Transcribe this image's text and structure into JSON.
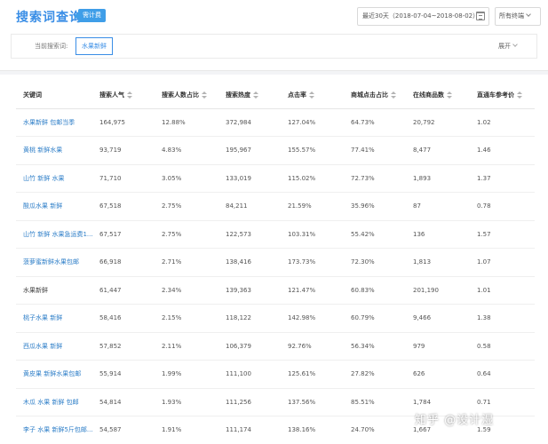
{
  "header": {
    "title": "搜索词查询",
    "badge": "需计费",
    "date_range": "最近30天（2018-07-04~2018-08-02）",
    "terminal_select": "所有终端"
  },
  "current_keyword": {
    "label": "当前搜索词:",
    "tag": "水果新鲜",
    "expand": "展开"
  },
  "table": {
    "columns": [
      "关键词",
      "搜索人气",
      "搜索人数占比",
      "搜索热度",
      "点击率",
      "商城点击占比",
      "在线商品数",
      "直通车参考价"
    ],
    "rows": [
      [
        "水果新鲜 包邮当季",
        "164,975",
        "12.88%",
        "372,984",
        "127.04%",
        "64.73%",
        "20,792",
        "1.02"
      ],
      [
        "黄桃 新鲜水果",
        "93,719",
        "4.83%",
        "195,967",
        "155.57%",
        "77.41%",
        "8,477",
        "1.46"
      ],
      [
        "山竹 新鲜 水果",
        "71,710",
        "3.05%",
        "133,019",
        "115.02%",
        "72.73%",
        "1,893",
        "1.37"
      ],
      [
        "酸瓜水果 新鲜",
        "67,518",
        "2.75%",
        "84,211",
        "21.59%",
        "35.96%",
        "87",
        "0.78"
      ],
      [
        "山竹 新鲜 水果急运费1...",
        "67,517",
        "2.75%",
        "122,573",
        "103.31%",
        "55.42%",
        "136",
        "1.57"
      ],
      [
        "菠萝蜜新鲜水果包邮",
        "66,918",
        "2.71%",
        "138,416",
        "173.73%",
        "72.30%",
        "1,813",
        "1.07"
      ],
      [
        "水果新鲜",
        "61,447",
        "2.34%",
        "139,363",
        "121.47%",
        "60.83%",
        "201,190",
        "1.01"
      ],
      [
        "桃子水果 新鲜",
        "58,416",
        "2.15%",
        "118,122",
        "142.98%",
        "60.79%",
        "9,466",
        "1.38"
      ],
      [
        "西瓜水果 新鲜",
        "57,852",
        "2.11%",
        "106,379",
        "92.76%",
        "56.34%",
        "979",
        "0.58"
      ],
      [
        "黄皮果 新鲜水果包邮",
        "55,914",
        "1.99%",
        "111,100",
        "125.61%",
        "27.82%",
        "626",
        "0.64"
      ],
      [
        "木瓜 水果 新鲜 包邮",
        "54,814",
        "1.93%",
        "111,256",
        "137.56%",
        "85.51%",
        "1,784",
        "0.71"
      ],
      [
        "李子 水果 新鲜5斤包邮...",
        "54,587",
        "1.91%",
        "111,174",
        "138.16%",
        "24.70%",
        "1,667",
        "1.59"
      ]
    ]
  },
  "watermark": "知乎 @设计湿",
  "colors": {
    "accent": "#3a8ee6",
    "link": "#2f7fc8",
    "badge": "#3f9ee8"
  }
}
